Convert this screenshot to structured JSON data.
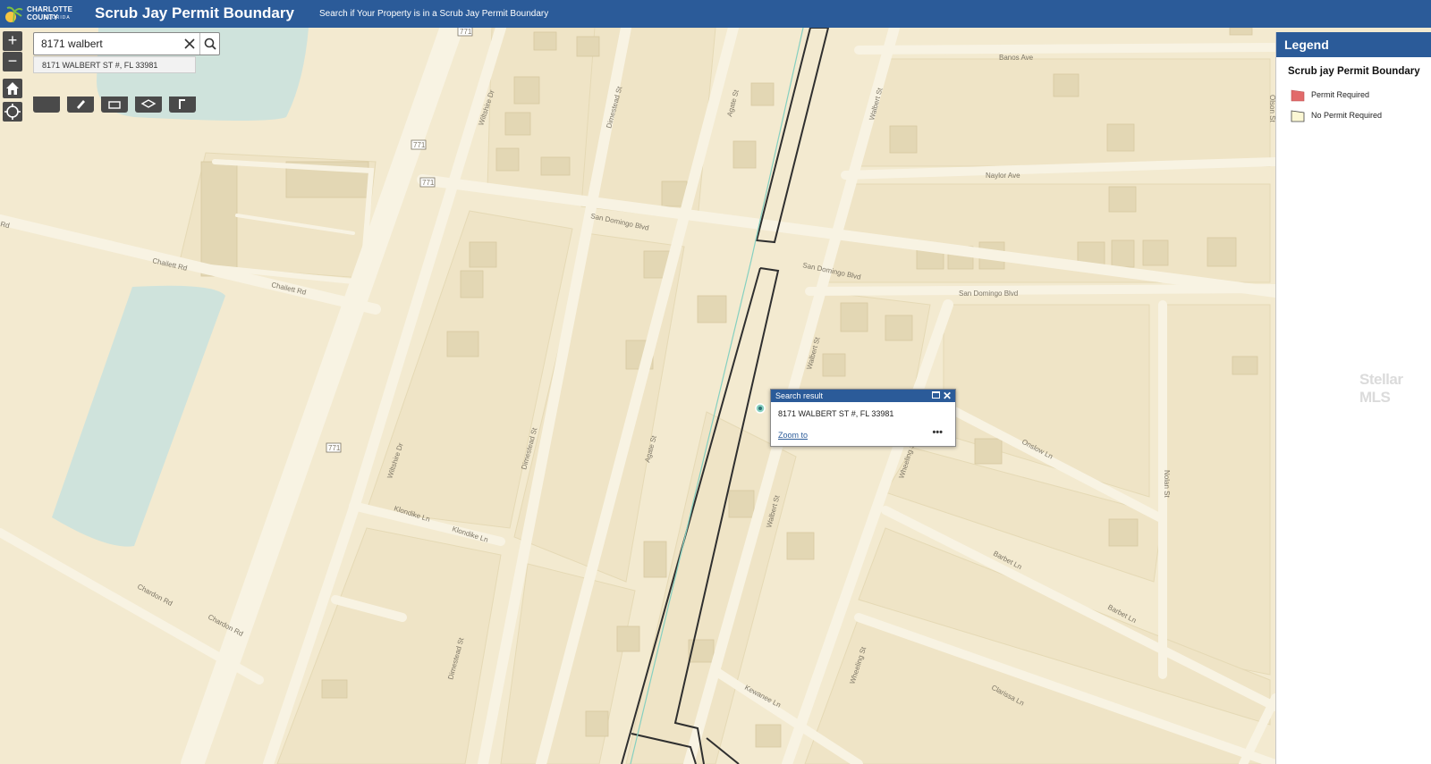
{
  "header": {
    "logo_line1": "CHARLOTTE COUNTY",
    "logo_line2": "FLORIDA",
    "title": "Scrub Jay Permit Boundary",
    "subtitle": "Search if Your Property is in a Scrub Jay Permit Boundary"
  },
  "search": {
    "value": "8171 walbert",
    "suggestion": "8171 WALBERT ST #, FL 33981"
  },
  "zoom": {
    "in_label": "+",
    "out_label": "−"
  },
  "popup": {
    "title": "Search result",
    "address": "8171 WALBERT ST #, FL 33981",
    "zoom_label": "Zoom to",
    "more_label": "•••"
  },
  "legend": {
    "title": "Legend",
    "layer_title": "Scrub jay Permit Boundary",
    "items": [
      {
        "label": "Permit Required",
        "color": "#e26a6a"
      },
      {
        "label": "No Permit Required",
        "color": "#fbf7d4"
      }
    ]
  },
  "map": {
    "roads": {
      "banos": "Banos Ave",
      "naylor": "Naylor Ave",
      "san_domingo": "San Domingo Blvd",
      "chailett": "Chailett Rd",
      "rd": "Rd",
      "wiltshire": "Wiltshire Dr",
      "dimestead": "Dimestead St",
      "agate": "Agate St",
      "walbert": "Walbert St",
      "wheeling": "Wheeling St",
      "nolan": "Nolan St",
      "onslow": "Onslow Ln",
      "barbet": "Barbet Ln",
      "clarissa": "Clarissa Ln",
      "kewanee": "Kewanee Ln",
      "klondike": "Klondike Ln",
      "chardon": "Chardon Rd",
      "olson": "Olson St",
      "hwy": "771"
    }
  },
  "watermark": "Stellar MLS",
  "colors": {
    "header_bg": "#2b5b99",
    "map_bg": "#f3ead0",
    "water": "#cfe3dc",
    "boundary": "#2f2f2f"
  }
}
